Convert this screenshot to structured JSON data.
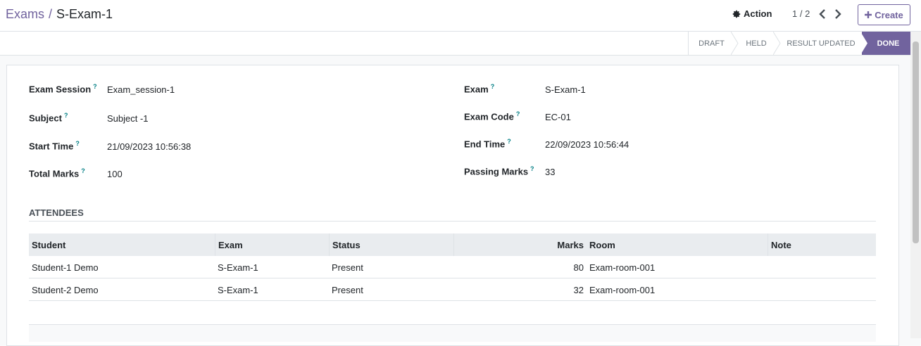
{
  "breadcrumb": {
    "parent": "Exams",
    "current": "S-Exam-1"
  },
  "control": {
    "action_label": "Action",
    "pager": "1 / 2",
    "create_label": "Create"
  },
  "stages": [
    "DRAFT",
    "HELD",
    "RESULT UPDATED",
    "DONE"
  ],
  "active_stage": "DONE",
  "fields": {
    "exam_session": {
      "label": "Exam Session",
      "value": "Exam_session-1"
    },
    "subject": {
      "label": "Subject",
      "value": "Subject -1"
    },
    "start_time": {
      "label": "Start Time",
      "value": "21/09/2023 10:56:38"
    },
    "total_marks": {
      "label": "Total Marks",
      "value": "100"
    },
    "exam": {
      "label": "Exam",
      "value": "S-Exam-1"
    },
    "exam_code": {
      "label": "Exam Code",
      "value": "EC-01"
    },
    "end_time": {
      "label": "End Time",
      "value": "22/09/2023 10:56:44"
    },
    "passing_marks": {
      "label": "Passing Marks",
      "value": "33"
    }
  },
  "help_marker": "?",
  "attendees": {
    "title": "ATTENDEES",
    "columns": [
      "Student",
      "Exam",
      "Status",
      "Marks",
      "Room",
      "Note"
    ],
    "rows": [
      [
        "Student-1 Demo",
        "S-Exam-1",
        "Present",
        "80",
        "Exam-room-001",
        ""
      ],
      [
        "Student-2 Demo",
        "S-Exam-1",
        "Present",
        "32",
        "Exam-room-001",
        ""
      ]
    ]
  },
  "colors": {
    "brand": "#71639e",
    "help": "#017e84"
  }
}
